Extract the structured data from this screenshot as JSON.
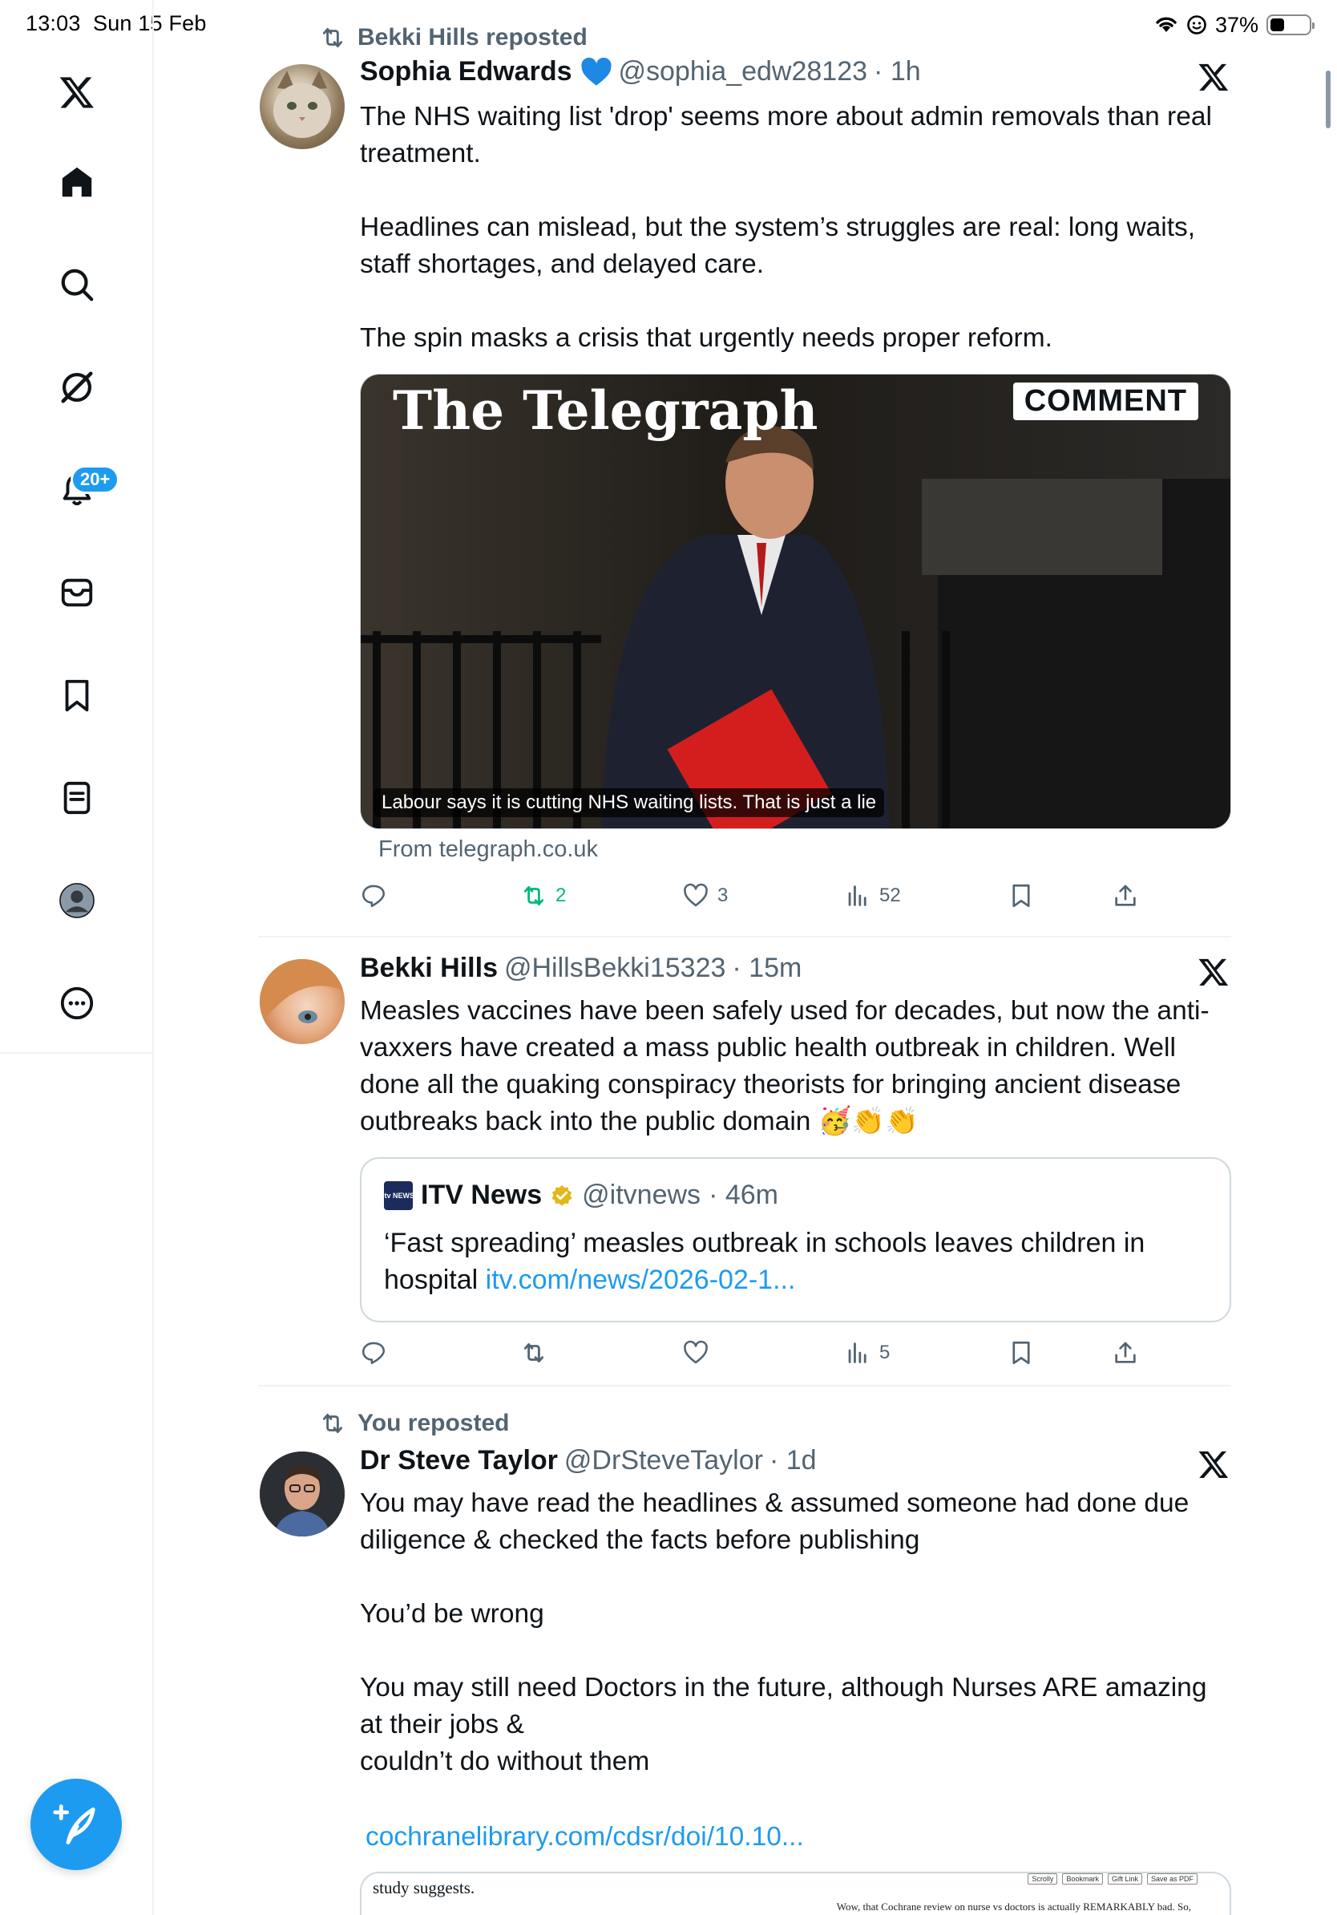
{
  "status_bar": {
    "time": "13:03",
    "date": "Sun 15 Feb",
    "battery": "37%",
    "battery_level": 0.37
  },
  "sidebar": {
    "items": [
      {
        "name": "x-logo-icon"
      },
      {
        "name": "home-icon"
      },
      {
        "name": "search-icon"
      },
      {
        "name": "grok-icon"
      },
      {
        "name": "notifications-icon"
      },
      {
        "name": "messages-icon"
      },
      {
        "name": "bookmarks-icon"
      },
      {
        "name": "lists-icon"
      },
      {
        "name": "profile-avatar-icon"
      },
      {
        "name": "more-icon"
      }
    ],
    "notification_badge": "20+",
    "compose_icon": "compose-post-icon"
  },
  "tweets": [
    {
      "repost_label": "Bekki Hills reposted",
      "name": "Sophia Edwards",
      "verified_icon": "blue-heart",
      "handle": "@sophia_edw28123",
      "time": "· 1h",
      "text": "The NHS waiting list 'drop' seems more about admin removals than real treatment.\n\nHeadlines can mislead, but the system’s struggles are real: long waits, staff shortages, and delayed care.\n\nThe spin masks a crisis that urgently needs proper reform.",
      "media": {
        "masthead": "The Telegraph",
        "tag": "COMMENT",
        "caption": "Labour says it is cutting NHS waiting lists. That is just a lie",
        "source": "From telegraph.co.uk"
      },
      "actions": {
        "replies": "",
        "reposts": "2",
        "likes": "3",
        "views": "52"
      }
    },
    {
      "name": "Bekki Hills",
      "handle": "@HillsBekki15323",
      "time": "· 15m",
      "text": "Measles vaccines have been safely used for decades, but now the anti-vaxxers have created a mass public health outbreak in children. Well done all the quaking conspiracy theorists for bringing ancient disease outbreaks back into the public domain 🥳👏👏",
      "quote": {
        "logo_text": "itv NEWS",
        "name": "ITV News",
        "handle": "@itvnews",
        "time": "· 46m",
        "text": "‘Fast spreading’ measles outbreak in schools leaves children in hospital ",
        "link": "itv.com/news/2026-02-1..."
      },
      "actions": {
        "replies": "",
        "reposts": "",
        "likes": "",
        "views": "5"
      }
    },
    {
      "repost_label": "You reposted",
      "name": "Dr Steve Taylor",
      "handle": "@DrSteveTaylor",
      "time": "· 1d",
      "text": "You may have read the headlines & assumed someone had done due diligence & checked the facts before publishing\n\nYou’d be wrong\n\nYou may still need Doctors in the future, although Nurses ARE amazing at their jobs &\ncouldn’t do without them",
      "link": "cochranelibrary.com/cdsr/doi/10.10...",
      "preview": {
        "text": "study suggests.",
        "tools": [
          "Scrolly",
          "Bookmark",
          "Gift Link",
          "Save as PDF"
        ],
        "note": "Wow, that Cochrane review on nurse vs doctors is actually REMARKABLY bad. So,"
      }
    }
  ],
  "colors": {
    "accent": "#1d9bf0",
    "repost_green": "#00ba7c",
    "text_secondary": "#536471"
  }
}
